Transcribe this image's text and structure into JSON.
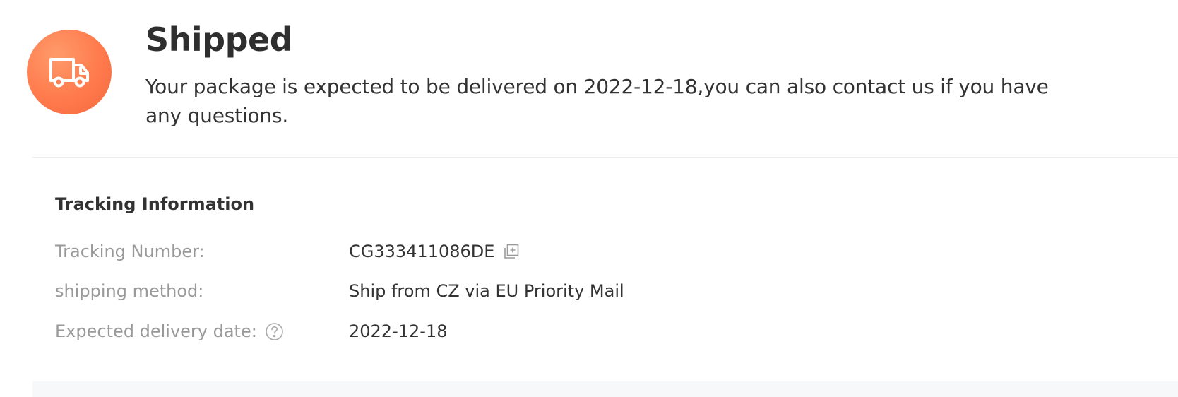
{
  "status": {
    "icon": "truck-icon",
    "icon_color": "#ff7a4c",
    "title": "Shipped",
    "message": "Your package is expected to be delivered on 2022-12-18,you can also contact us if you have any questions."
  },
  "tracking": {
    "heading": "Tracking Information",
    "rows": [
      {
        "label": "Tracking Number:",
        "value": "CG333411086DE",
        "action_icon": "copy-icon"
      },
      {
        "label": "shipping method:",
        "value": "Ship from CZ via EU Priority Mail"
      },
      {
        "label": "Expected delivery date:",
        "label_icon": "question-circle-icon",
        "value": "2022-12-18"
      }
    ]
  },
  "colors": {
    "accent": "#ff7a4c",
    "label_text": "#999999",
    "value_text": "#333333"
  }
}
